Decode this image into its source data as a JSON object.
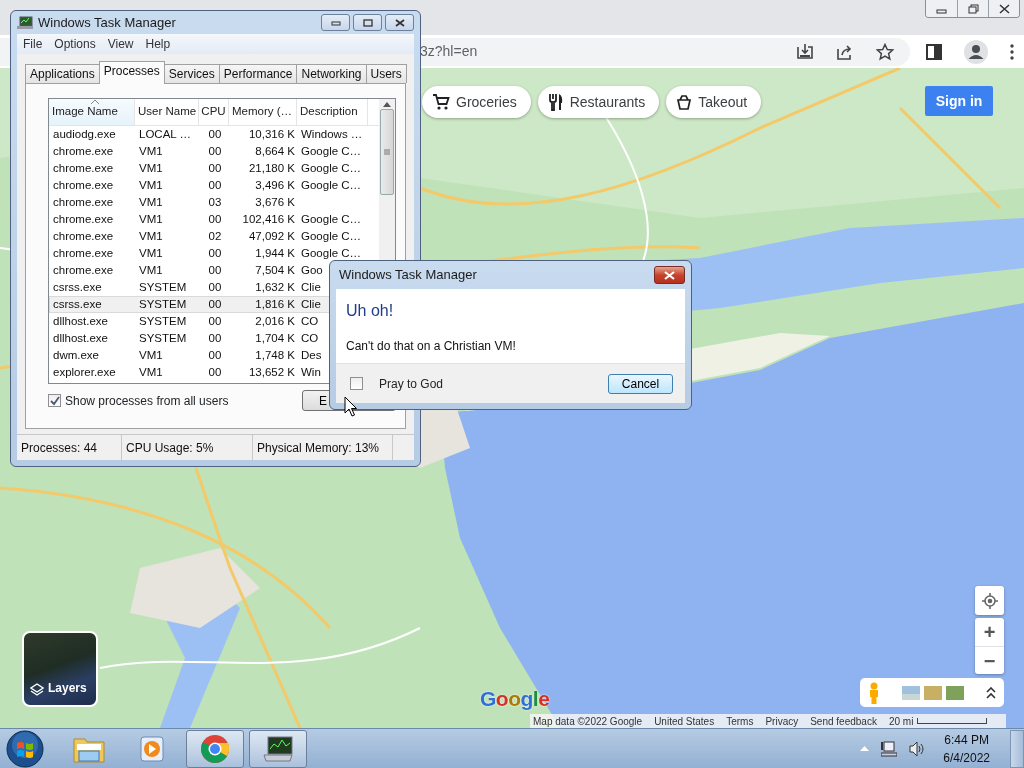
{
  "browser": {
    "url_fragment": "3z?hl=en"
  },
  "map": {
    "chips": [
      {
        "label": "Groceries",
        "kind": "cart"
      },
      {
        "label": "Restaurants",
        "kind": "cutlery"
      },
      {
        "label": "Takeout",
        "kind": "takeout"
      }
    ],
    "sign_in": "Sign in",
    "layers_label": "Layers",
    "logo_text": "Google",
    "zoom_in": "+",
    "zoom_out": "−",
    "footer": [
      "Map data ©2022 Google",
      "United States",
      "Terms",
      "Privacy",
      "Send feedback"
    ],
    "scale": "20 mi"
  },
  "task_manager": {
    "title": "Windows Task Manager",
    "menu": [
      "File",
      "Options",
      "View",
      "Help"
    ],
    "tabs": [
      {
        "label": "Applications",
        "selected": false
      },
      {
        "label": "Processes",
        "selected": true
      },
      {
        "label": "Services",
        "selected": false
      },
      {
        "label": "Performance",
        "selected": false
      },
      {
        "label": "Networking",
        "selected": false
      },
      {
        "label": "Users",
        "selected": false
      }
    ],
    "columns": [
      "Image Name",
      "User Name",
      "CPU",
      "Memory (…",
      "Description"
    ],
    "rows": [
      {
        "image": "audiodg.exe",
        "user": "LOCAL …",
        "cpu": "00",
        "memory": "10,316 K",
        "description": "Windows …",
        "selected": false
      },
      {
        "image": "chrome.exe",
        "user": "VM1",
        "cpu": "00",
        "memory": "8,664 K",
        "description": "Google C…",
        "selected": false
      },
      {
        "image": "chrome.exe",
        "user": "VM1",
        "cpu": "00",
        "memory": "21,180 K",
        "description": "Google C…",
        "selected": false
      },
      {
        "image": "chrome.exe",
        "user": "VM1",
        "cpu": "00",
        "memory": "3,496 K",
        "description": "Google C…",
        "selected": false
      },
      {
        "image": "chrome.exe",
        "user": "VM1",
        "cpu": "03",
        "memory": "3,676 K",
        "selected": false
      },
      {
        "image": "chrome.exe",
        "user": "VM1",
        "cpu": "00",
        "memory": "102,416 K",
        "description": "Google C…",
        "selected": false
      },
      {
        "image": "chrome.exe",
        "user": "VM1",
        "cpu": "02",
        "memory": "47,092 K",
        "description": "Google C…",
        "selected": false
      },
      {
        "image": "chrome.exe",
        "user": "VM1",
        "cpu": "00",
        "memory": "1,944 K",
        "description": "Google C…",
        "selected": false
      },
      {
        "image": "chrome.exe",
        "user": "VM1",
        "cpu": "00",
        "memory": "7,504 K",
        "description": "Goo",
        "selected": false
      },
      {
        "image": "csrss.exe",
        "user": "SYSTEM",
        "cpu": "00",
        "memory": "1,632 K",
        "description": "Clie",
        "selected": false
      },
      {
        "image": "csrss.exe",
        "user": "SYSTEM",
        "cpu": "00",
        "memory": "1,816 K",
        "description": "Clie",
        "selected": true
      },
      {
        "image": "dllhost.exe",
        "user": "SYSTEM",
        "cpu": "00",
        "memory": "2,016 K",
        "description": "CO",
        "selected": false
      },
      {
        "image": "dllhost.exe",
        "user": "SYSTEM",
        "cpu": "00",
        "memory": "1,704 K",
        "description": "CO",
        "selected": false
      },
      {
        "image": "dwm.exe",
        "user": "VM1",
        "cpu": "00",
        "memory": "1,748 K",
        "description": "Des",
        "selected": false
      },
      {
        "image": "explorer.exe",
        "user": "VM1",
        "cpu": "00",
        "memory": "13,652 K",
        "description": "Win",
        "selected": false
      }
    ],
    "show_all_users": {
      "label": "Show processes from all users",
      "checked": true
    },
    "end_button": "E",
    "status": [
      "Processes: 44",
      "CPU Usage: 5%",
      "Physical Memory: 13%"
    ]
  },
  "dialog": {
    "title": "Windows Task Manager",
    "heading": "Uh oh!",
    "message": "Can't do that on a Christian VM!",
    "checkbox": {
      "label": "Pray to God",
      "checked": false
    },
    "cancel": "Cancel"
  },
  "taskbar": {
    "apps": [
      {
        "kind": "explorer",
        "open": false
      },
      {
        "kind": "media",
        "open": false
      },
      {
        "kind": "chrome",
        "open": true
      },
      {
        "kind": "taskmgr",
        "open": true
      }
    ],
    "time": "6:44 PM",
    "date": "6/4/2022"
  }
}
